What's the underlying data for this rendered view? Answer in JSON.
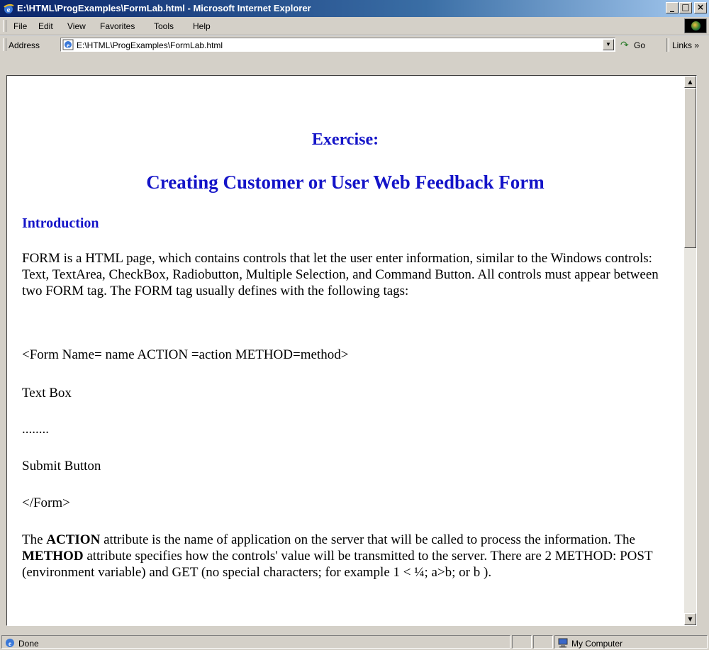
{
  "window": {
    "title": "E:\\HTML\\ProgExamples\\FormLab.html - Microsoft Internet Explorer",
    "icon": "ie-icon",
    "buttons": [
      "minimize",
      "maximize",
      "close"
    ]
  },
  "menu": {
    "items": [
      "File",
      "Edit",
      "View",
      "Favorites",
      "Tools",
      "Help"
    ]
  },
  "address": {
    "label": "Address",
    "url": "E:\\HTML\\ProgExamples\\FormLab.html",
    "go_label": "Go",
    "links_label": "Links »"
  },
  "content": {
    "heading_exercise": "Exercise:",
    "heading_main": "Creating Customer or User Web Feedback Form",
    "heading_intro": "Introduction",
    "paragraph1": "FORM is a HTML page, which contains controls that let the user enter information, similar to the Windows controls: Text, TextArea, CheckBox, Radiobutton, Multiple Selection, and Command Button. All controls must appear between two FORM tag. The FORM tag usually defines with the following tags:",
    "line_form_open": "<Form Name= name ACTION =action METHOD=method>",
    "line_text_box": "Text Box",
    "line_dots": "........",
    "line_submit": "Submit Button",
    "line_form_close": "</Form>",
    "p2_the": "The",
    "p2_action": "ACTION",
    "p2_mid": "attribute is the name of application on the server that will be called to process the information. The",
    "p2_method": "METHOD",
    "p2_end": "attribute specifies how the controls' value will be transmitted to the server. There are 2 METHOD: POST (environment variable) and GET (no special characters; for example 1 < ¼; a>b; or b )."
  },
  "status": {
    "text": "Done",
    "zone": "My Computer"
  }
}
